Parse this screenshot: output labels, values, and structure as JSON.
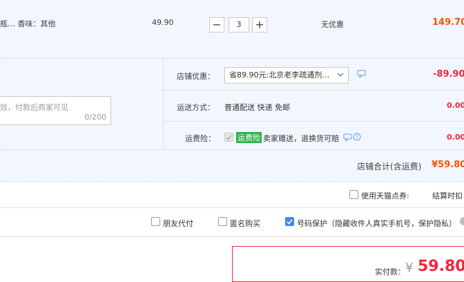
{
  "item": {
    "attr_text": "瓶…  香味：其他",
    "unit_price": "49.90",
    "quantity": "3",
    "minus_label": "−",
    "plus_label": "+",
    "discount_text": "无优惠",
    "subtotal": "149.70"
  },
  "store": {
    "coupon_label": "店铺优惠：",
    "coupon_selected": "省89.90元:北京老李疏通剂…",
    "coupon_amount": "-89.90",
    "shipping_label": "运送方式：",
    "shipping_value": "普通配送 快递 免邮",
    "shipping_amount": "0.00",
    "insurance_label": "运费险：",
    "insurance_badge": "运费险",
    "insurance_text": "卖家赠送，退换货可赔",
    "insurance_amount": "0.00",
    "message_placeholder": "效，付款后商家可见",
    "message_counter": "0/200",
    "total_label": "店铺合计(含运费)",
    "total_value": "¥59.80"
  },
  "points": {
    "label": "使用天猫点券:",
    "note": "结算时扣"
  },
  "options": {
    "friend_pay": "朋友代付",
    "anonymous": "匿名购买",
    "number_protect": "号码保护（隐藏收件人真实手机号，保护隐私）",
    "number_protect_checked": true
  },
  "payment": {
    "label": "实付款：",
    "currency": "¥",
    "amount": "59.80"
  },
  "colors": {
    "accent_red": "#f2263b",
    "accent_orange": "#ff5000",
    "panel_blue": "#f2f7ff",
    "checkbox_blue": "#3f87f5",
    "badge_green": "#2eb24a"
  }
}
